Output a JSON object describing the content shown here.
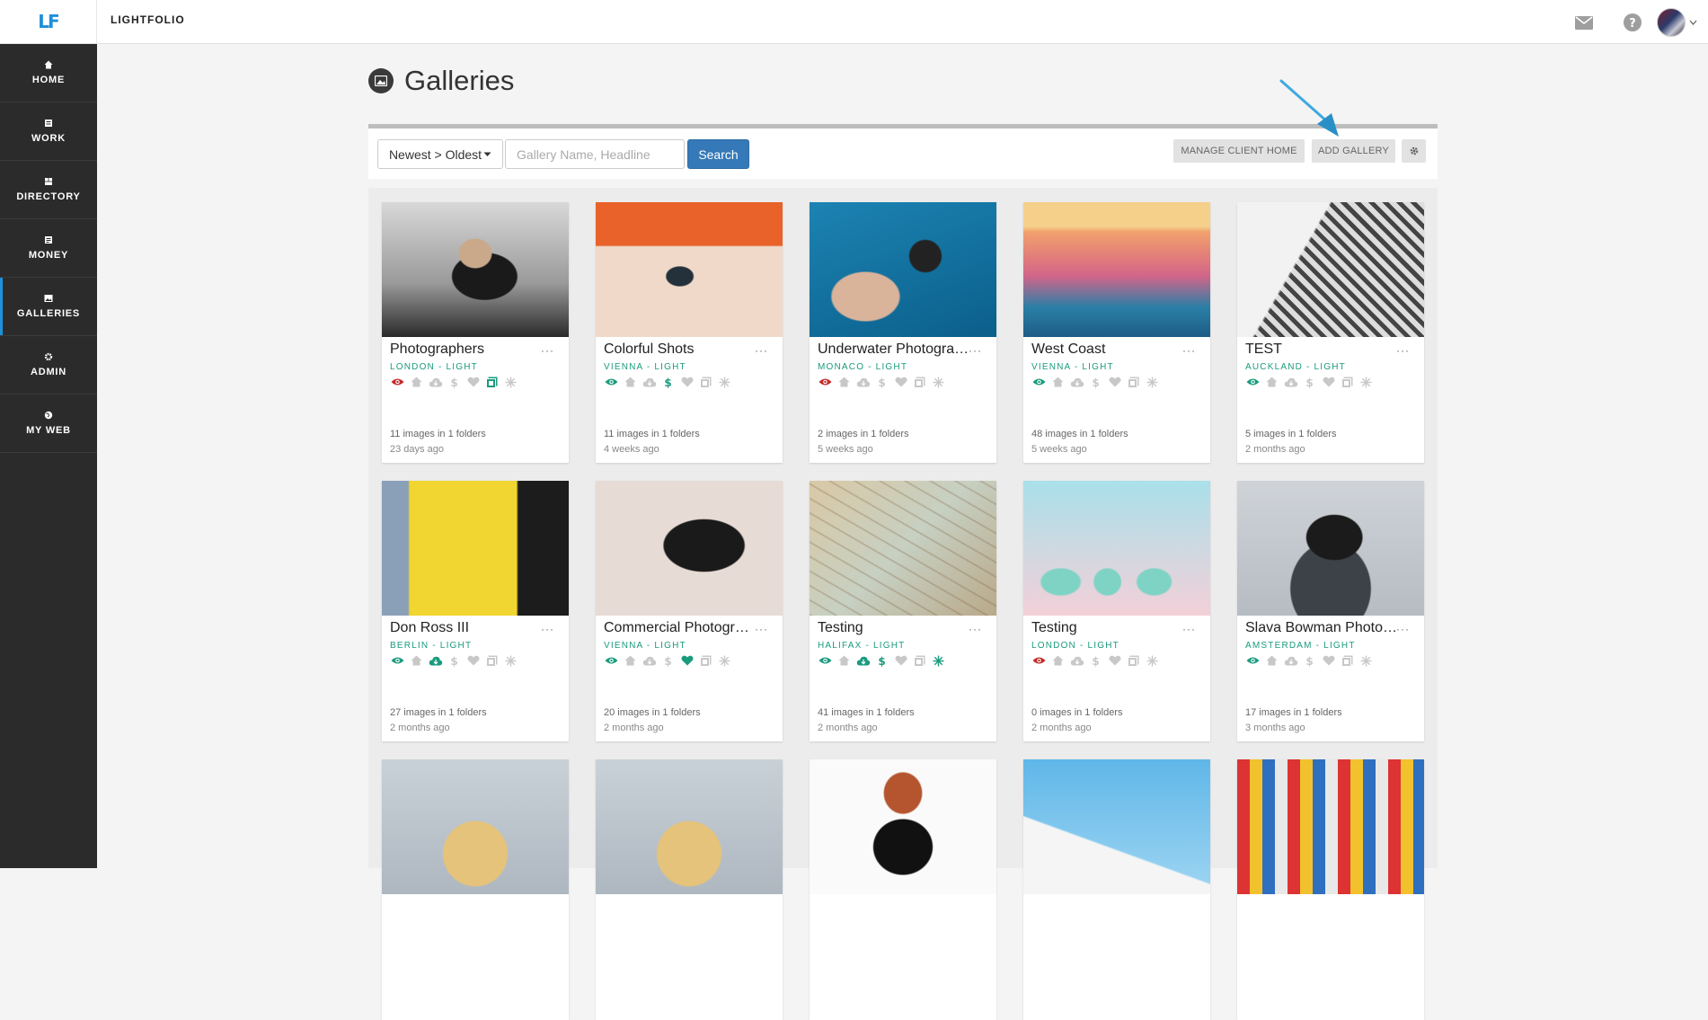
{
  "app": {
    "logo": "LF",
    "brand": "LIGHTFOLIO"
  },
  "header_icons": [
    "mail-icon",
    "help-icon",
    "avatar"
  ],
  "sidebar": {
    "items": [
      {
        "label": "HOME",
        "icon": "home-icon",
        "active": false
      },
      {
        "label": "WORK",
        "icon": "work-icon",
        "active": false
      },
      {
        "label": "DIRECTORY",
        "icon": "directory-icon",
        "active": false
      },
      {
        "label": "MONEY",
        "icon": "money-icon",
        "active": false
      },
      {
        "label": "GALLERIES",
        "icon": "galleries-icon",
        "active": true
      },
      {
        "label": "ADMIN",
        "icon": "gear-icon",
        "active": false
      },
      {
        "label": "MY WEB",
        "icon": "globe-icon",
        "active": false
      }
    ]
  },
  "page": {
    "title": "Galleries",
    "icon": "image-icon"
  },
  "toolbar": {
    "sort_label": "Newest > Oldest",
    "search_placeholder": "Gallery Name, Headline",
    "search_label": "Search",
    "manage_label": "MANAGE CLIENT HOME",
    "add_label": "ADD GALLERY"
  },
  "colors": {
    "accent": "#1e8fd9",
    "location": "#1a9b7e",
    "active_icon": "#1a9b7e",
    "hidden_icon": "#c62828",
    "search_button": "#3579b8"
  },
  "galleries": [
    {
      "title": "Photographers",
      "location": "LONDON - LIGHT",
      "count": "11 images in 1 folders",
      "date": "23 days ago",
      "visibility": "red",
      "active": [
        "folder"
      ]
    },
    {
      "title": "Colorful Shots",
      "location": "VIENNA - LIGHT",
      "count": "11 images in 1 folders",
      "date": "4 weeks ago",
      "visibility": "green",
      "active": [
        "dollar"
      ]
    },
    {
      "title": "Underwater Photography",
      "location": "MONACO - LIGHT",
      "count": "2 images in 1 folders",
      "date": "5 weeks ago",
      "visibility": "red",
      "active": []
    },
    {
      "title": "West Coast",
      "location": "VIENNA - LIGHT",
      "count": "48 images in 1 folders",
      "date": "5 weeks ago",
      "visibility": "green",
      "active": []
    },
    {
      "title": "TEST",
      "location": "AUCKLAND - LIGHT",
      "count": "5 images in 1 folders",
      "date": "2 months ago",
      "visibility": "green",
      "active": []
    },
    {
      "title": "Don Ross III",
      "location": "BERLIN - LIGHT",
      "count": "27 images in 1 folders",
      "date": "2 months ago",
      "visibility": "green",
      "active": [
        "cloud"
      ]
    },
    {
      "title": "Commercial Photography",
      "location": "VIENNA - LIGHT",
      "count": "20 images in 1 folders",
      "date": "2 months ago",
      "visibility": "green",
      "active": [
        "heart"
      ]
    },
    {
      "title": "Testing",
      "location": "HALIFAX - LIGHT",
      "count": "41 images in 1 folders",
      "date": "2 months ago",
      "visibility": "green",
      "active": [
        "cloud",
        "dollar",
        "snow"
      ]
    },
    {
      "title": "Testing",
      "location": "LONDON - LIGHT",
      "count": "0 images in 1 folders",
      "date": "2 months ago",
      "visibility": "red",
      "active": []
    },
    {
      "title": "Slava Bowman Photography",
      "location": "AMSTERDAM - LIGHT",
      "count": "17 images in 1 folders",
      "date": "3 months ago",
      "visibility": "green",
      "active": []
    },
    {
      "title": "",
      "location": "",
      "count": "",
      "date": "",
      "visibility": "",
      "active": []
    },
    {
      "title": "",
      "location": "",
      "count": "",
      "date": "",
      "visibility": "",
      "active": []
    },
    {
      "title": "",
      "location": "",
      "count": "",
      "date": "",
      "visibility": "",
      "active": []
    },
    {
      "title": "",
      "location": "",
      "count": "",
      "date": "",
      "visibility": "",
      "active": []
    },
    {
      "title": "",
      "location": "",
      "count": "",
      "date": "",
      "visibility": "",
      "active": []
    }
  ],
  "card_more_label": "···"
}
